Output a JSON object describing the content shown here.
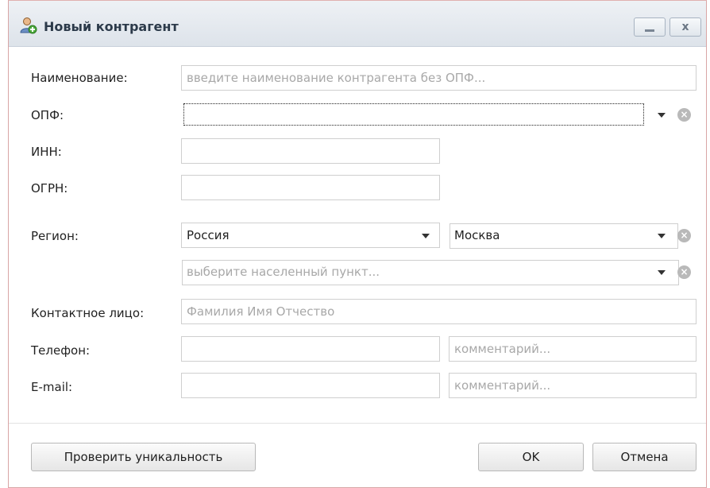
{
  "window": {
    "title": "Новый контрагент",
    "minimize_glyph": "_",
    "close_glyph": "x"
  },
  "form": {
    "name_label": "Наименование:",
    "name_placeholder": "введите наименование контрагента без ОПФ...",
    "opf_label": "ОПФ:",
    "opf_value": "",
    "inn_label": "ИНН:",
    "ogrn_label": "ОГРН:",
    "region_label": "Регион:",
    "country_value": "Россия",
    "region_value": "Москва",
    "locality_placeholder": "выберите населенный пункт...",
    "contact_label": "Контактное лицо:",
    "contact_placeholder": "Фамилия Имя Отчество",
    "phone_label": "Телефон:",
    "phone_comment_placeholder": "комментарий...",
    "email_label": "E-mail:",
    "email_comment_placeholder": "комментарий..."
  },
  "buttons": {
    "check_unique": "Проверить уникальность",
    "ok": "OK",
    "cancel": "Отмена"
  },
  "icons": {
    "title": "user-add-icon",
    "dropdown": "chevron-down-icon",
    "clear": "clear-circle-icon"
  }
}
